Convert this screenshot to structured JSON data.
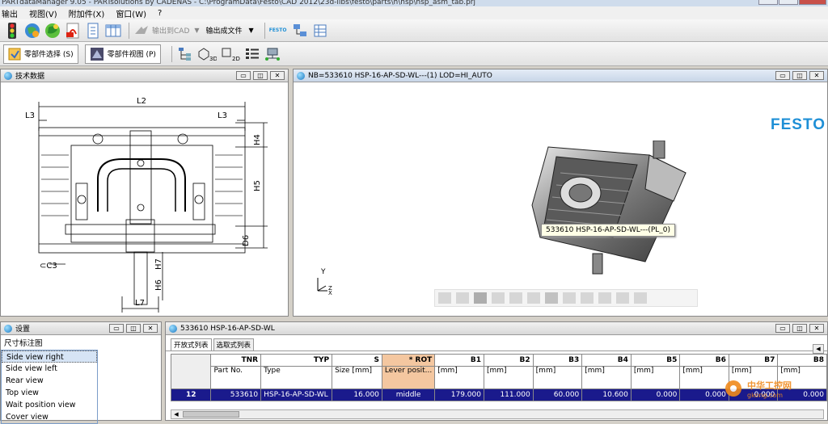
{
  "window": {
    "title": "PARTdataManager 9.05 - PARTsolutions by CADENAS - C:\\ProgramData\\Festo\\CAD 2012\\23d-libs\\festo\\parts\\h\\hsp\\hsp_asm_tab.prj"
  },
  "menu": [
    "输出",
    "视图(V)",
    "附加件(X)",
    "窗口(W)",
    "?"
  ],
  "toolbar1": {
    "export_cad_label": "输出到CAD",
    "export_file_label": "输出成文件",
    "brand_small": "FESTO"
  },
  "toolbar2": {
    "part_select_label": "零部件选择 (S)",
    "part_view_label": "零部件视图 (P)"
  },
  "tech_panel": {
    "title": "技术数据",
    "dims": {
      "l2": "L2",
      "l3a": "L3",
      "l3b": "L3",
      "h4": "H4",
      "h5": "H5",
      "d6": "D6",
      "h7": "H7",
      "h6": "H6",
      "l7": "L7",
      "c3": "⊂C3"
    }
  },
  "view3d": {
    "title": "NB=533610 HSP-16-AP-SD-WL---(1) LOD=HI_AUTO",
    "brand": "FESTO",
    "tooltip": "533610 HSP-16-AP-SD-WL---(PL_0)",
    "axis_y": "Y",
    "axis_z": "Z",
    "axis_x": "X"
  },
  "settings_panel": {
    "title": "设置",
    "section": "尺寸标注图",
    "items": [
      "Side view right",
      "Side view left",
      "Rear view",
      "Top view",
      "Wait position view",
      "Cover view"
    ],
    "selected_index": 0
  },
  "table_panel": {
    "title": "533610 HSP-16-AP-SD-WL",
    "tabs": [
      "开放式列表",
      "选取式列表"
    ],
    "columns": [
      {
        "code": "TNR",
        "desc": "Part No."
      },
      {
        "code": "TYP",
        "desc": "Type"
      },
      {
        "code": "S",
        "desc": "Size [mm]"
      },
      {
        "code": "* ROT",
        "desc": "Lever posit..."
      },
      {
        "code": "B1",
        "desc": "[mm]"
      },
      {
        "code": "B2",
        "desc": "[mm]"
      },
      {
        "code": "B3",
        "desc": "[mm]"
      },
      {
        "code": "B4",
        "desc": "[mm]"
      },
      {
        "code": "B5",
        "desc": "[mm]"
      },
      {
        "code": "B6",
        "desc": "[mm]"
      },
      {
        "code": "B7",
        "desc": "[mm]"
      },
      {
        "code": "B8",
        "desc": "[mm]"
      }
    ],
    "row": {
      "index": "12",
      "values": [
        "533610",
        "HSP-16-AP-SD-WL",
        "16.000",
        "middle",
        "179.000",
        "111.000",
        "60.000",
        "10.600",
        "0.000",
        "0.000",
        "0.000",
        "0.000"
      ]
    }
  },
  "watermark": {
    "cn": "中华工控网",
    "url": "gkong.com"
  },
  "colors": {
    "selection": "#1a1a8c",
    "highlight_col": "#f4c7a0",
    "brand": "#1e8fd6"
  }
}
